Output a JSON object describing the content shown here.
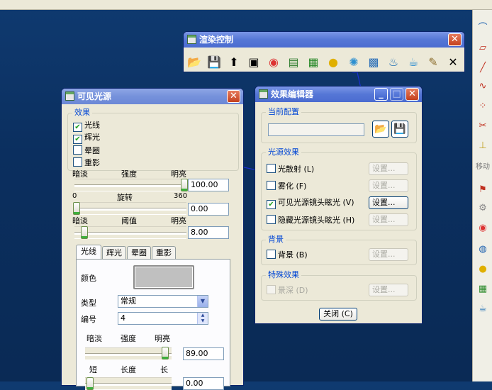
{
  "render_toolbar": {
    "title": "渲染控制",
    "close_glyph": "✕",
    "icons": [
      "open-folder-icon",
      "save-disk-icon",
      "export-icon",
      "material-icon",
      "color-wheel-icon",
      "scene-icon",
      "texture-icon",
      "light-bulb-icon",
      "light-effect-icon",
      "room-icon",
      "teapot-render-icon",
      "teapot-icon",
      "paint-brush-icon",
      "close-x-icon"
    ]
  },
  "visible_light": {
    "title": "可见光源",
    "effects_group": "效果",
    "effects": [
      {
        "label": "光线",
        "checked": true
      },
      {
        "label": "辉光",
        "checked": true
      },
      {
        "label": "晕圈",
        "checked": false
      },
      {
        "label": "重影",
        "checked": false
      }
    ],
    "sliders": [
      {
        "left": "暗淡",
        "center": "强度",
        "right": "明亮",
        "value": "100.00",
        "level": 1.0
      },
      {
        "left": "0",
        "center": "旋转",
        "right": "360",
        "value": "0.00",
        "level": 0.0
      },
      {
        "left": "暗淡",
        "center": "阈值",
        "right": "明亮",
        "value": "8.00",
        "level": 0.08
      }
    ],
    "tabs": [
      "光线",
      "辉光",
      "晕圈",
      "重影"
    ],
    "color_label": "颜色",
    "color_value": "#c0c0c0",
    "type_label": "类型",
    "type_value": "常规",
    "number_label": "编号",
    "number_value": "4",
    "inner_slider": {
      "left": "暗淡",
      "center": "强度",
      "right": "明亮",
      "value": "89.00",
      "level": 0.89
    },
    "length_labels": {
      "left": "短",
      "center": "长度",
      "right": "长"
    },
    "length_value": "0.00"
  },
  "effect_editor": {
    "title": "效果编辑器",
    "current_config": "当前配置",
    "config_value": "",
    "light_effects_group": "光源效果",
    "light_effects": [
      {
        "label": "光散射 (L)",
        "checked": false,
        "enabled": true,
        "button": "设置...",
        "button_enabled": false
      },
      {
        "label": "雾化 (F)",
        "checked": false,
        "enabled": true,
        "button": "设置...",
        "button_enabled": false
      },
      {
        "label": "可见光源镜头眩光 (V)",
        "checked": true,
        "enabled": true,
        "button": "设置...",
        "button_enabled": true
      },
      {
        "label": "隐藏光源镜头眩光 (H)",
        "checked": false,
        "enabled": true,
        "button": "设置...",
        "button_enabled": false
      }
    ],
    "background_group": "背景",
    "background": {
      "label": "背景 (B)",
      "checked": false,
      "button": "设置..."
    },
    "special_group": "特殊效果",
    "depth": {
      "label": "景深 (D)",
      "checked": false,
      "button": "设置..."
    },
    "close_button": "关闭 (C)"
  },
  "right_toolbar": {
    "move_label": "移动",
    "icons": [
      "curve-icon",
      "parallelogram-icon",
      "line-icon",
      "wave-icon",
      "point-icon",
      "trim-icon",
      "dimension-icon",
      "flag-icon",
      "tool-icon",
      "color-icon",
      "globe-icon",
      "bulb-icon",
      "texture-icon",
      "teapot-icon"
    ]
  }
}
